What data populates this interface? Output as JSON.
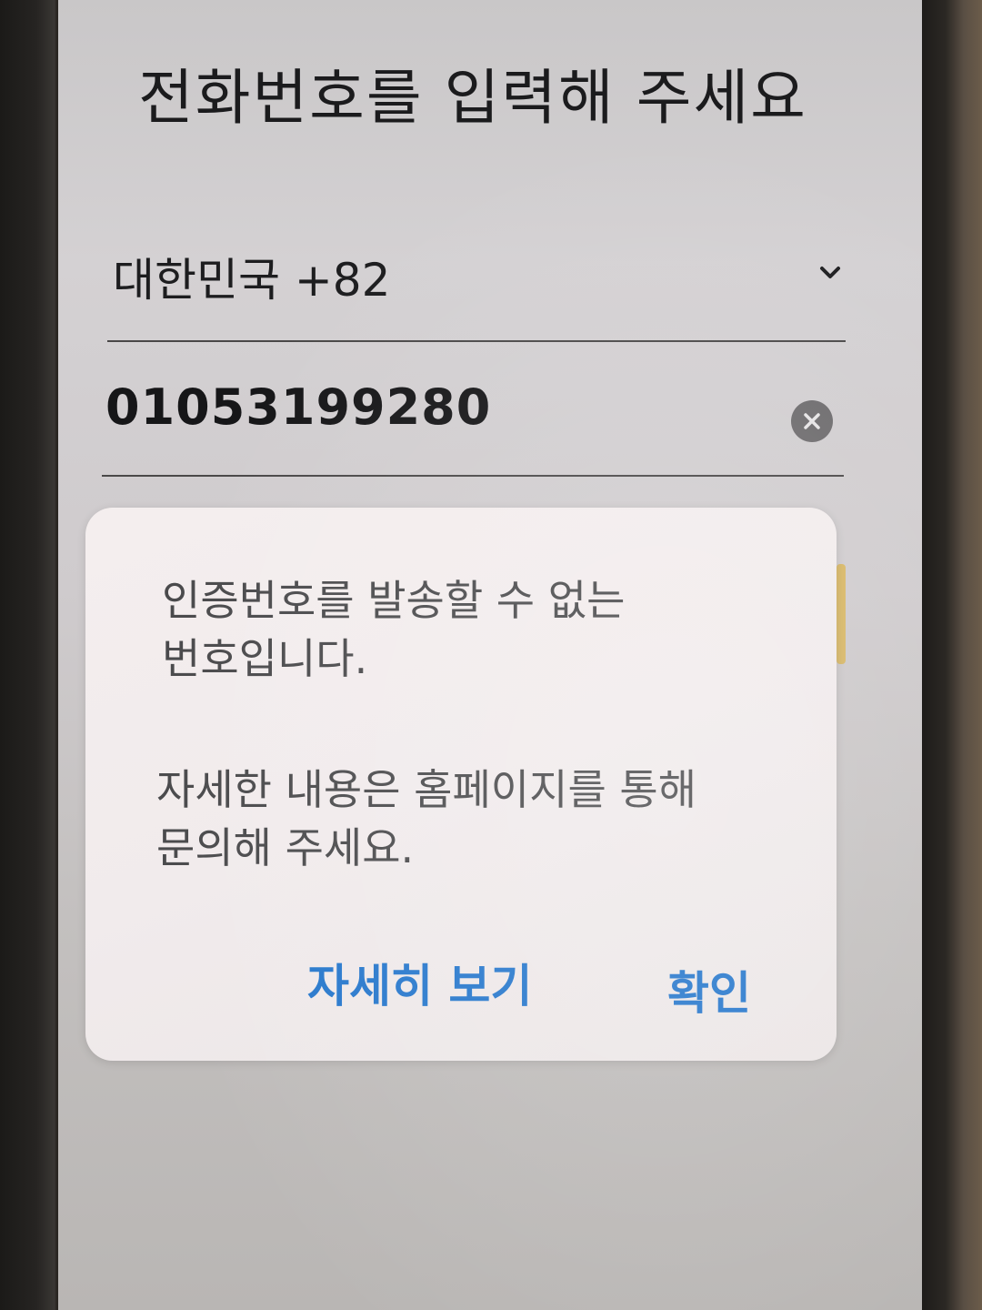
{
  "header": {
    "title": "전화번호를 입력해 주세요"
  },
  "form": {
    "country_value": "대한민국 +82",
    "phone_value": "01053199280"
  },
  "dialog": {
    "message_line1": "인증번호를 발송할 수 없는",
    "message_line2": "번호입니다.",
    "message_line3": "자세한 내용은 홈페이지를 통해",
    "message_line4": "문의해 주세요.",
    "detail_button": "자세히 보기",
    "confirm_button": "확인"
  },
  "colors": {
    "accent": "#2677cc",
    "text_dark": "#1b1b1d",
    "dialog_text": "#4a4a4c"
  },
  "icons": {
    "country_dropdown": "chevron-down-icon",
    "clear_input": "clear-circle-icon"
  }
}
